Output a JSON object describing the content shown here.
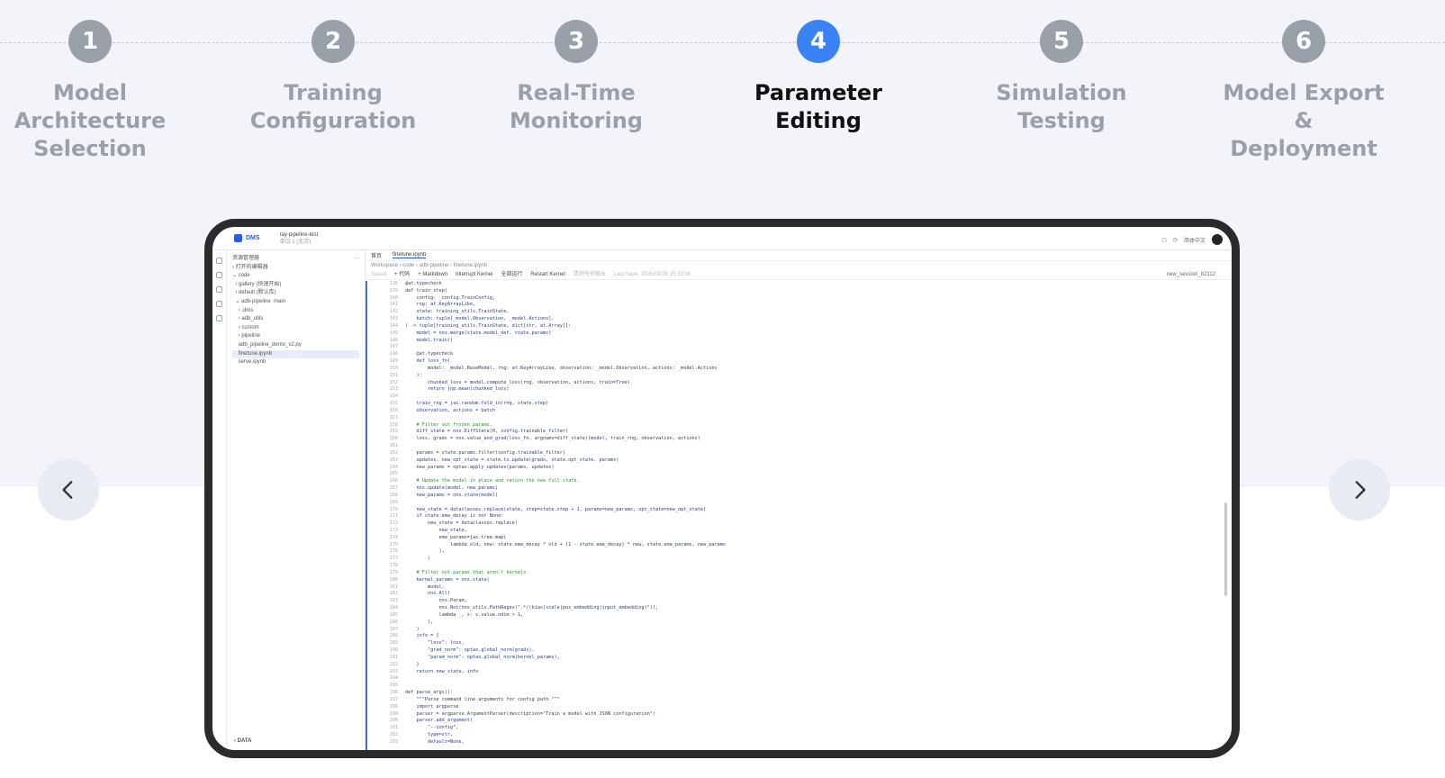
{
  "steps": [
    {
      "number": "1",
      "label": "Model\nArchitecture\nSelection"
    },
    {
      "number": "2",
      "label": "Training\nConfiguration"
    },
    {
      "number": "3",
      "label": "Real-Time\nMonitoring"
    },
    {
      "number": "4",
      "label": "Parameter\nEditing"
    },
    {
      "number": "5",
      "label": "Simulation\nTesting"
    },
    {
      "number": "6",
      "label": "Model Export\n& Deployment"
    }
  ],
  "active_step": 4,
  "colors": {
    "active": "#3b82f6",
    "inactive": "#9aa0aa"
  },
  "nav": {
    "prev_icon": "chevron-left-icon",
    "next_icon": "chevron-right-icon"
  },
  "app": {
    "logo": "DMS",
    "project": "ray-pipeline-test",
    "project_sub": "单日 1 (北京)",
    "lang": "简体中文",
    "tabs": [
      "首页",
      "finetune.ipynb"
    ],
    "breadcrumb": "Workspace  ›  code  ›  adb-pipeline  ›  finetune.ipynb",
    "toolbar": [
      "Saved",
      "+ 代码",
      "+ Markdown",
      "Interrupt Kernel",
      "全部运行",
      "Restart Kernel",
      "清除所有输出",
      "Last Save: 2025/09/28 15:33:58"
    ],
    "session": "new_session_82112",
    "tree_header": "资源管理器",
    "tree": [
      "› 打开的编辑器",
      "⌄ code",
      "  › gallery (快速开始)",
      "  › default (默认库)",
      "  ⌄ adb-pipeline  main",
      "    › .dms",
      "    › adb_utils",
      "    › custom",
      "    › pipeline",
      "    adb_pipeline_demo_v2.py",
      "    finetune.ipynb",
      "    serve.ipynb"
    ],
    "tree_selected": 10,
    "tree_bottom": "› DATA",
    "code": [
      [
        "138",
        "@at.typecheck"
      ],
      [
        "139",
        "def train_step("
      ],
      [
        "140",
        "    config: _config.TrainConfig,"
      ],
      [
        "141",
        "    rng: at.KeyArrayLike,"
      ],
      [
        "142",
        "    state: training_utils.TrainState,"
      ],
      [
        "143",
        "    batch: tuple[_model.Observation, _model.Actions],"
      ],
      [
        "144",
        ") -> tuple[training_utils.TrainState, dict[str, at.Array]]:"
      ],
      [
        "145",
        "    model = nnx.merge(state.model_def, state.params)"
      ],
      [
        "146",
        "    model.train()"
      ],
      [
        "147",
        ""
      ],
      [
        "148",
        "    @at.typecheck"
      ],
      [
        "149",
        "    def loss_fn("
      ],
      [
        "150",
        "        model: _model.BaseModel, rng: at.KeyArrayLike, observation: _model.Observation, actions: _model.Actions"
      ],
      [
        "151",
        "    ):"
      ],
      [
        "152",
        "        chunked_loss = model.compute_loss(rng, observation, actions, train=True)"
      ],
      [
        "153",
        "        return jnp.mean(chunked_loss)"
      ],
      [
        "154",
        ""
      ],
      [
        "155",
        "    train_rng = jax.random.fold_in(rng, state.step)"
      ],
      [
        "156",
        "    observation, actions = batch"
      ],
      [
        "157",
        ""
      ],
      [
        "158",
        "    # Filter out frozen params."
      ],
      [
        "159",
        "    diff_state = nnx.DiffState(0, config.trainable_filter)"
      ],
      [
        "160",
        "    loss, grads = nnx.value_and_grad(loss_fn, argnums=diff_state)(model, train_rng, observation, actions)"
      ],
      [
        "161",
        ""
      ],
      [
        "162",
        "    params = state.params.filter(config.trainable_filter)"
      ],
      [
        "163",
        "    updates, new_opt_state = state.tx.update(grads, state.opt_state, params)"
      ],
      [
        "164",
        "    new_params = optax.apply_updates(params, updates)"
      ],
      [
        "165",
        ""
      ],
      [
        "166",
        "    # Update the model in place and return the new full state."
      ],
      [
        "167",
        "    nnx.update(model, new_params)"
      ],
      [
        "168",
        "    new_params = nnx.state(model)"
      ],
      [
        "169",
        ""
      ],
      [
        "170",
        "    new_state = dataclasses.replace(state, step=state.step + 1, params=new_params, opt_state=new_opt_state)"
      ],
      [
        "171",
        "    if state.ema_decay is not None:"
      ],
      [
        "172",
        "        new_state = dataclasses.replace("
      ],
      [
        "173",
        "            new_state,"
      ],
      [
        "174",
        "            ema_params=jax.tree.map("
      ],
      [
        "175",
        "                lambda old, new: state.ema_decay * old + (1 - state.ema_decay) * new, state.ema_params, new_params"
      ],
      [
        "176",
        "            ),"
      ],
      [
        "177",
        "        )"
      ],
      [
        "178",
        ""
      ],
      [
        "179",
        "    # Filter out params that aren't kernels."
      ],
      [
        "180",
        "    kernel_params = nnx.state("
      ],
      [
        "181",
        "        model,"
      ],
      [
        "182",
        "        nnx.All("
      ],
      [
        "183",
        "            nnx.Param,"
      ],
      [
        "184",
        "            nnx.Not(nnx_utils.PathRegex(\".*/(bias|scale|pos_embedding|input_embedding)\")),"
      ],
      [
        "185",
        "            lambda _, x: x.value.ndim > 1,"
      ],
      [
        "186",
        "        ),"
      ],
      [
        "187",
        "    )"
      ],
      [
        "188",
        "    info = {"
      ],
      [
        "189",
        "        \"loss\": loss,"
      ],
      [
        "190",
        "        \"grad_norm\": optax.global_norm(grads),"
      ],
      [
        "191",
        "        \"param_norm\": optax.global_norm(kernel_params),"
      ],
      [
        "192",
        "    }"
      ],
      [
        "193",
        "    return new_state, info"
      ],
      [
        "194",
        ""
      ],
      [
        "195",
        ""
      ],
      [
        "196",
        "def parse_args():"
      ],
      [
        "197",
        "    \"\"\"Parse command line arguments for config path.\"\"\""
      ],
      [
        "198",
        "    import argparse"
      ],
      [
        "199",
        "    parser = argparse.ArgumentParser(description=\"Train a model with JSON configuration\")"
      ],
      [
        "200",
        "    parser.add_argument("
      ],
      [
        "201",
        "        \"--config\","
      ],
      [
        "202",
        "        type=str,"
      ],
      [
        "203",
        "        default=None,"
      ]
    ]
  }
}
